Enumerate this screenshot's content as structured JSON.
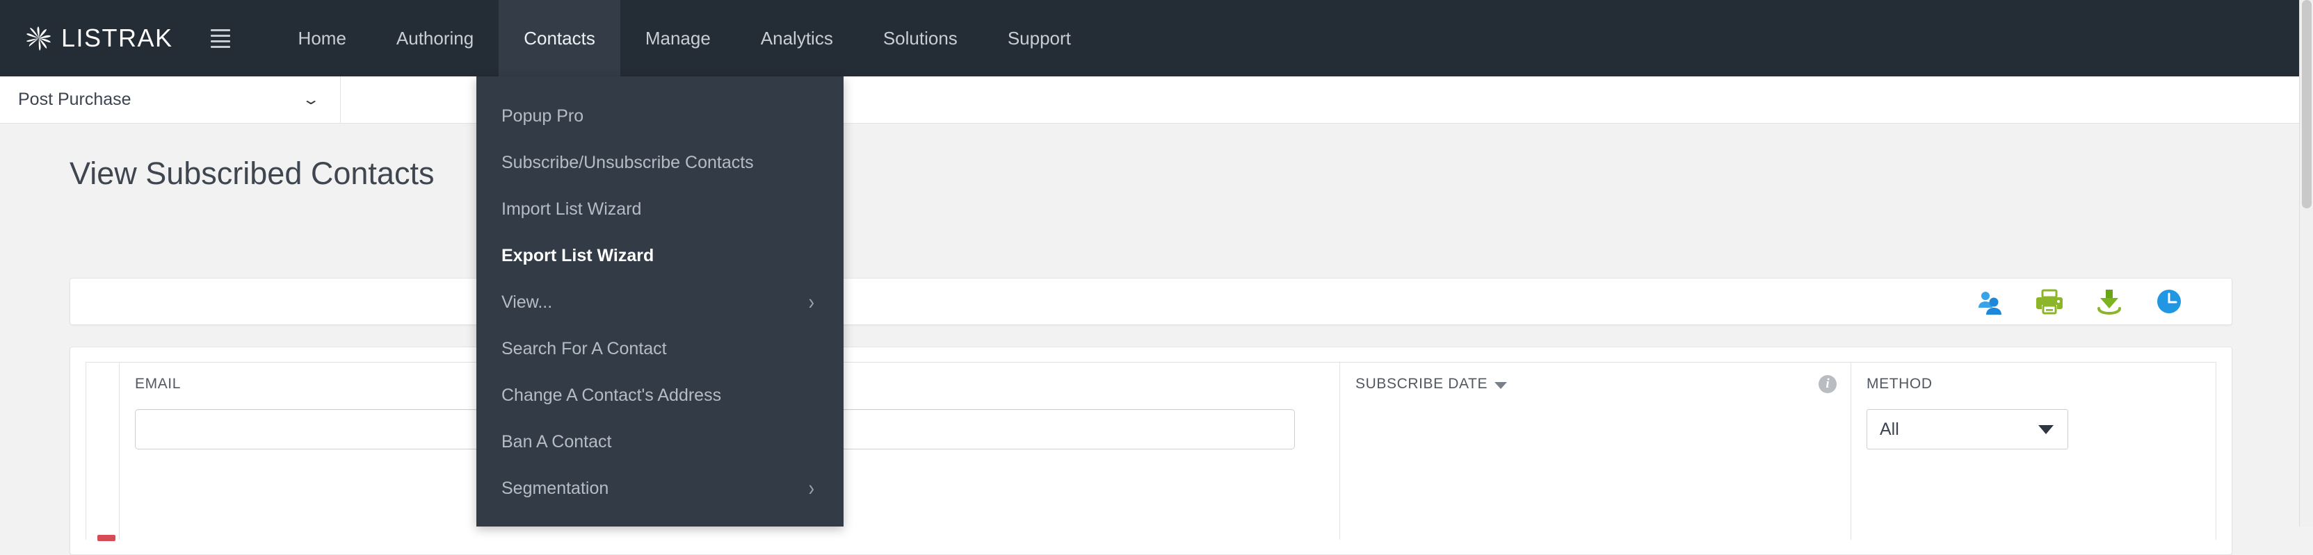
{
  "brand": {
    "name": "LISTRAK",
    "logo_icon": "pinwheel-logo-icon",
    "menu_icon": "hamburger-menu-icon"
  },
  "topnav": {
    "bg_color": "#242c35",
    "active_bg_color": "#343d47",
    "items": [
      {
        "label": "Home",
        "active": false
      },
      {
        "label": "Authoring",
        "active": false
      },
      {
        "label": "Contacts",
        "active": true
      },
      {
        "label": "Manage",
        "active": false
      },
      {
        "label": "Analytics",
        "active": false
      },
      {
        "label": "Solutions",
        "active": false
      },
      {
        "label": "Support",
        "active": false
      }
    ]
  },
  "contacts_dropdown": {
    "bg_color": "#333c46",
    "items": [
      {
        "label": "Popup Pro",
        "bold": false,
        "submenu": false
      },
      {
        "label": "Subscribe/Unsubscribe Contacts",
        "bold": false,
        "submenu": false
      },
      {
        "label": "Import List Wizard",
        "bold": false,
        "submenu": false
      },
      {
        "label": "Export List Wizard",
        "bold": true,
        "submenu": false
      },
      {
        "label": "View...",
        "bold": false,
        "submenu": true
      },
      {
        "label": "Search For A Contact",
        "bold": false,
        "submenu": false
      },
      {
        "label": "Change A Contact's Address",
        "bold": false,
        "submenu": false
      },
      {
        "label": "Ban A Contact",
        "bold": false,
        "submenu": false
      },
      {
        "label": "Segmentation",
        "bold": false,
        "submenu": true
      }
    ],
    "submenu_icon": "chevron-right-icon"
  },
  "subbar": {
    "list_selector": {
      "value": "Post Purchase",
      "caret_icon": "chevron-down-icon"
    }
  },
  "page": {
    "title": "View Subscribed Contacts"
  },
  "toolbar": {
    "icons": [
      {
        "name": "add-contacts-icon",
        "color": "#2196e3"
      },
      {
        "name": "print-icon",
        "color": "#8cb52a"
      },
      {
        "name": "download-icon",
        "color": "#8cb52a"
      },
      {
        "name": "schedule-clock-icon",
        "color": "#2196e3"
      }
    ]
  },
  "filter_table": {
    "columns": [
      {
        "key": "select",
        "header": "",
        "type": "checkbox"
      },
      {
        "key": "email",
        "header": "EMAIL",
        "type": "text",
        "value": "",
        "placeholder": ""
      },
      {
        "key": "subscribe_date",
        "header": "SUBSCRIBE DATE",
        "type": "date",
        "sortable": true,
        "sort_icon": "sort-descending-caret-icon",
        "info_icon": "info-icon",
        "info_label": "i"
      },
      {
        "key": "method",
        "header": "METHOD",
        "type": "select",
        "value": "All",
        "caret_icon": "dropdown-caret-icon"
      }
    ]
  }
}
